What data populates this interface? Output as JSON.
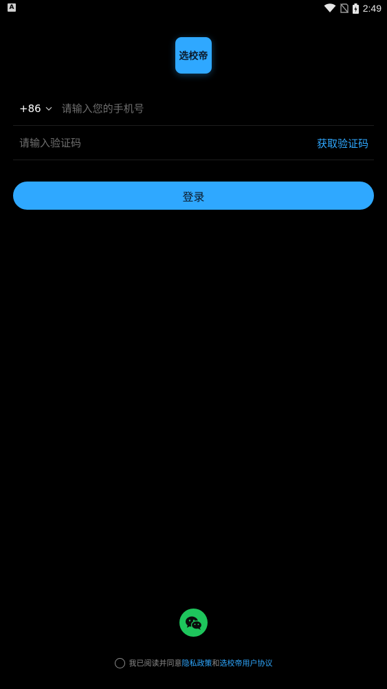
{
  "status_bar": {
    "app_indicator": "A",
    "time": "2:49",
    "icons": [
      "wifi-icon",
      "no-sim-icon",
      "battery-charging-icon"
    ]
  },
  "logo": {
    "text": "选校帝"
  },
  "phone_row": {
    "country_code": "+86",
    "phone_placeholder": "请输入您的手机号"
  },
  "code_row": {
    "code_placeholder": "请输入验证码",
    "get_code_label": "获取验证码"
  },
  "login": {
    "label": "登录"
  },
  "social": {
    "icon": "wechat-icon"
  },
  "agreement": {
    "prefix": "我已阅读并同意",
    "privacy_link": "隐私政策",
    "joiner": "和",
    "terms_link": "选校帝用户协议"
  },
  "colors": {
    "accent": "#2fa8ff",
    "background": "#000000",
    "wechat": "#1ec55c",
    "placeholder": "#6e6e6e"
  }
}
